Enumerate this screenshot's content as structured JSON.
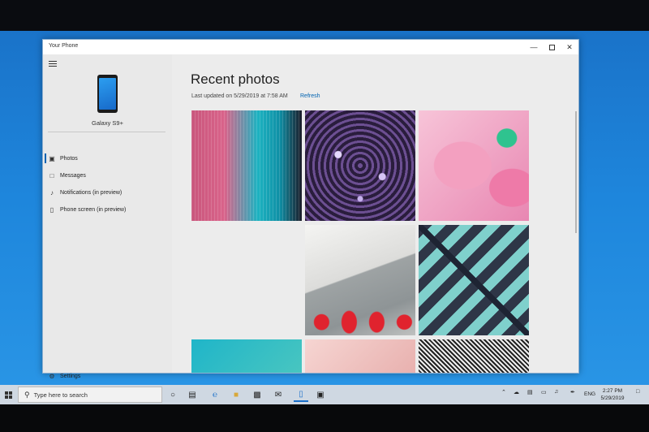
{
  "window": {
    "title": "Your Phone"
  },
  "sidebar": {
    "device_name": "Galaxy S9+",
    "items": [
      {
        "label": "Photos",
        "icon": "photo-icon",
        "active": true
      },
      {
        "label": "Messages",
        "icon": "message-icon",
        "active": false
      },
      {
        "label": "Notifications (in preview)",
        "icon": "bell-icon",
        "active": false
      },
      {
        "label": "Phone screen (in preview)",
        "icon": "phone-screen-icon",
        "active": false
      }
    ],
    "settings_label": "Settings"
  },
  "main": {
    "heading": "Recent photos",
    "last_updated": "Last updated on 5/29/2019 at 7:58 AM",
    "refresh_label": "Refresh",
    "photos": [
      "photo-1",
      "photo-2",
      "photo-3",
      "photo-4",
      "photo-5",
      "photo-6",
      "photo-7",
      "photo-8",
      "photo-9"
    ]
  },
  "taskbar": {
    "search_placeholder": "Type here to search",
    "language": "ENG",
    "time": "2:27 PM",
    "date": "5/29/2019"
  },
  "colors": {
    "accent": "#0063b1",
    "desktop": "#1e86dc"
  }
}
